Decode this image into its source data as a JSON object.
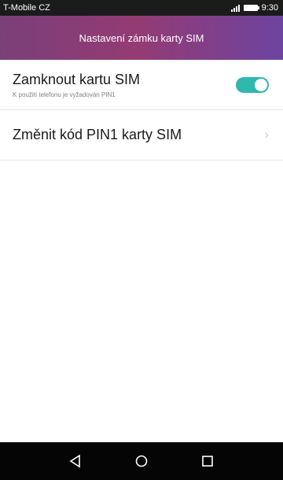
{
  "status_bar": {
    "carrier": "T-Mobile CZ",
    "time": "9:30"
  },
  "header": {
    "title": "Nastavení zámku karty SIM"
  },
  "settings": {
    "lock_sim": {
      "title": "Zamknout kartu SIM",
      "subtitle": "K použití telefonu je vyžadován PIN1",
      "enabled": true
    },
    "change_pin": {
      "title": "Změnit kód PIN1 karty SIM"
    }
  },
  "nav_bar": {
    "icons": [
      "back-icon",
      "home-icon",
      "recents-icon"
    ]
  },
  "colors": {
    "status_bar_bg": "#1b1b1b",
    "header_gradient_left": "#7a3f79",
    "header_gradient_mid": "#943b73",
    "header_gradient_right": "#6d44a0",
    "toggle_on": "#2fb7b0",
    "nav_bar_bg": "#050505"
  }
}
